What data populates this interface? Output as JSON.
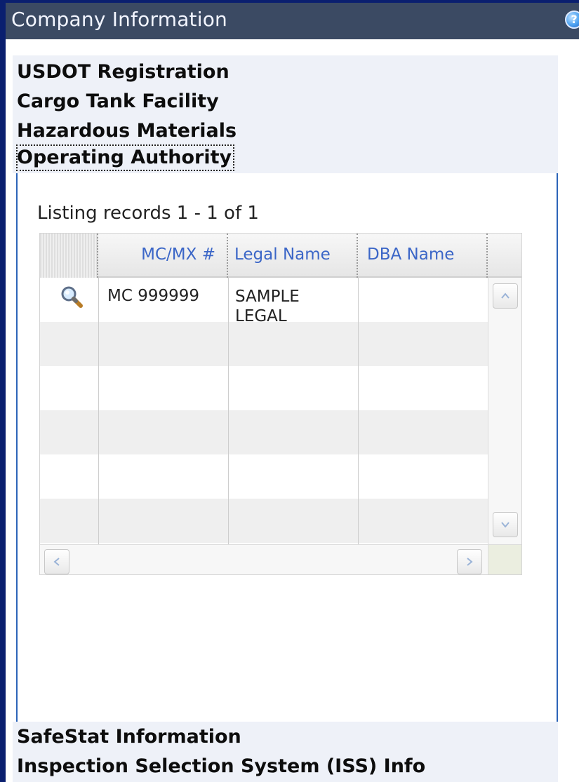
{
  "window": {
    "title": "Company Information",
    "help_icon": "help-icon"
  },
  "menu": {
    "items": [
      {
        "label": "USDOT Registration"
      },
      {
        "label": "Cargo Tank Facility"
      },
      {
        "label": "Hazardous Materials"
      },
      {
        "label": "Operating Authority"
      }
    ],
    "selected": "Operating Authority"
  },
  "panel": {
    "listing_text": "Listing records 1 - 1 of 1",
    "grid": {
      "columns": [
        {
          "label": ""
        },
        {
          "label": "MC/MX #"
        },
        {
          "label": "Legal Name"
        },
        {
          "label": "DBA Name"
        }
      ],
      "rows": [
        {
          "icon": "magnifier-icon",
          "mc_mx": "MC 999999",
          "legal_name": "SAMPLE LEGAL",
          "dba_name": ""
        }
      ]
    }
  },
  "bottom_menu": {
    "items": [
      {
        "label": "SafeStat Information"
      },
      {
        "label": "Inspection Selection System (ISS) Info"
      }
    ]
  },
  "colors": {
    "title_bar": "#3b4a63",
    "frame_border": "#0a1f6f",
    "menu_background": "#eef1f8",
    "accent": "#3b66c7"
  }
}
